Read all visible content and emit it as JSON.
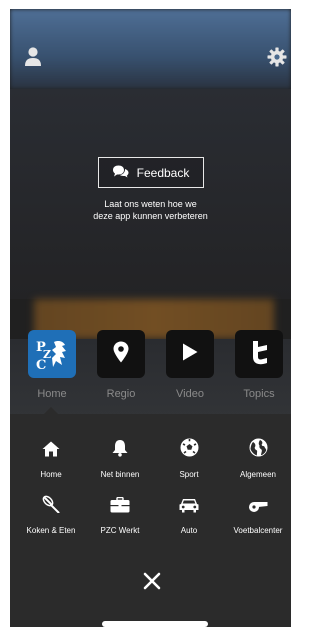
{
  "header": {
    "profile_icon": "user-icon",
    "settings_icon": "gear-icon"
  },
  "feedback": {
    "icon": "chat-bubbles-icon",
    "label": "Feedback",
    "message": "Laat ons weten hoe we\ndeze app kunnen verbeteren"
  },
  "tabs": [
    {
      "label": "Home",
      "icon": "pzc-logo",
      "active": true
    },
    {
      "label": "Regio",
      "icon": "location-pin-icon",
      "active": false
    },
    {
      "label": "Video",
      "icon": "play-icon",
      "active": false
    },
    {
      "label": "Topics",
      "icon": "topics-t-icon",
      "active": false
    }
  ],
  "logo": {
    "text": "PZC"
  },
  "menu": {
    "items": [
      {
        "label": "Home",
        "icon": "house-icon"
      },
      {
        "label": "Net binnen",
        "icon": "bell-icon"
      },
      {
        "label": "Sport",
        "icon": "soccer-ball-icon"
      },
      {
        "label": "Algemeen",
        "icon": "globe-icon"
      },
      {
        "label": "Koken & Eten",
        "icon": "whisk-icon"
      },
      {
        "label": "PZC Werkt",
        "icon": "briefcase-icon"
      },
      {
        "label": "Auto",
        "icon": "car-icon"
      },
      {
        "label": "Voetbalcenter",
        "icon": "whistle-icon"
      }
    ]
  },
  "close_icon": "close-icon",
  "colors": {
    "accent": "#1f6fb7",
    "panel": "#2b2b2b",
    "tile": "#111111",
    "label_muted": "#8a8a8a"
  }
}
